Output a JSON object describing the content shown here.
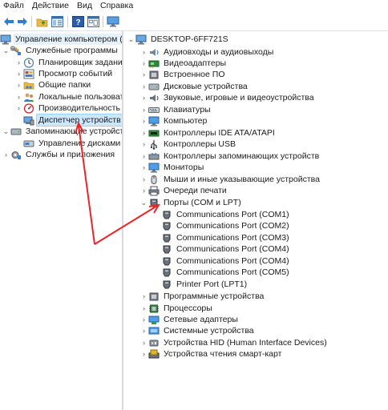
{
  "menu": [
    "Файл",
    "Действие",
    "Вид",
    "Справка"
  ],
  "left_tree": {
    "root": "Управление компьютером (л",
    "system_tools": "Служебные программы",
    "task_scheduler": "Планировщик заданий",
    "event_viewer": "Просмотр событий",
    "shared_folders": "Общие папки",
    "local_users": "Локальные пользовате",
    "performance": "Производительность",
    "device_manager": "Диспетчер устройств",
    "storage": "Запоминающие устройст",
    "disk_management": "Управление дисками",
    "services": "Службы и приложения"
  },
  "device_tree": {
    "computer_name": "DESKTOP-6FF721S",
    "audio_io": "Аудиовходы и аудиовыходы",
    "video_adapters": "Видеоадаптеры",
    "firmware": "Встроенное ПО",
    "disk_drives": "Дисковые устройства",
    "sound_video_game": "Звуковые, игровые и видеоустройства",
    "keyboards": "Клавиатуры",
    "computer": "Компьютер",
    "ide_controllers": "Контроллеры IDE ATA/ATAPI",
    "usb_controllers": "Контроллеры USB",
    "storage_controllers": "Контроллеры запоминающих устройств",
    "monitors": "Мониторы",
    "mice": "Мыши и иные указывающие устройства",
    "print_queues": "Очереди печати",
    "ports": "Порты (COM и LPT)",
    "port_items": [
      "Communications Port (COM1)",
      "Communications Port (COM2)",
      "Communications Port (COM3)",
      "Communications Port (COM4)",
      "Communications Port (COM4)",
      "Communications Port (COM5)",
      "Printer Port (LPT1)"
    ],
    "software_devices": "Программные устройства",
    "processors": "Процессоры",
    "network_adapters": "Сетевые адаптеры",
    "system_devices": "Системные устройства",
    "hid": "Устройства HID (Human Interface Devices)",
    "smart_card_readers": "Устройства чтения смарт-карт"
  },
  "annotation_color": "#e8262a"
}
